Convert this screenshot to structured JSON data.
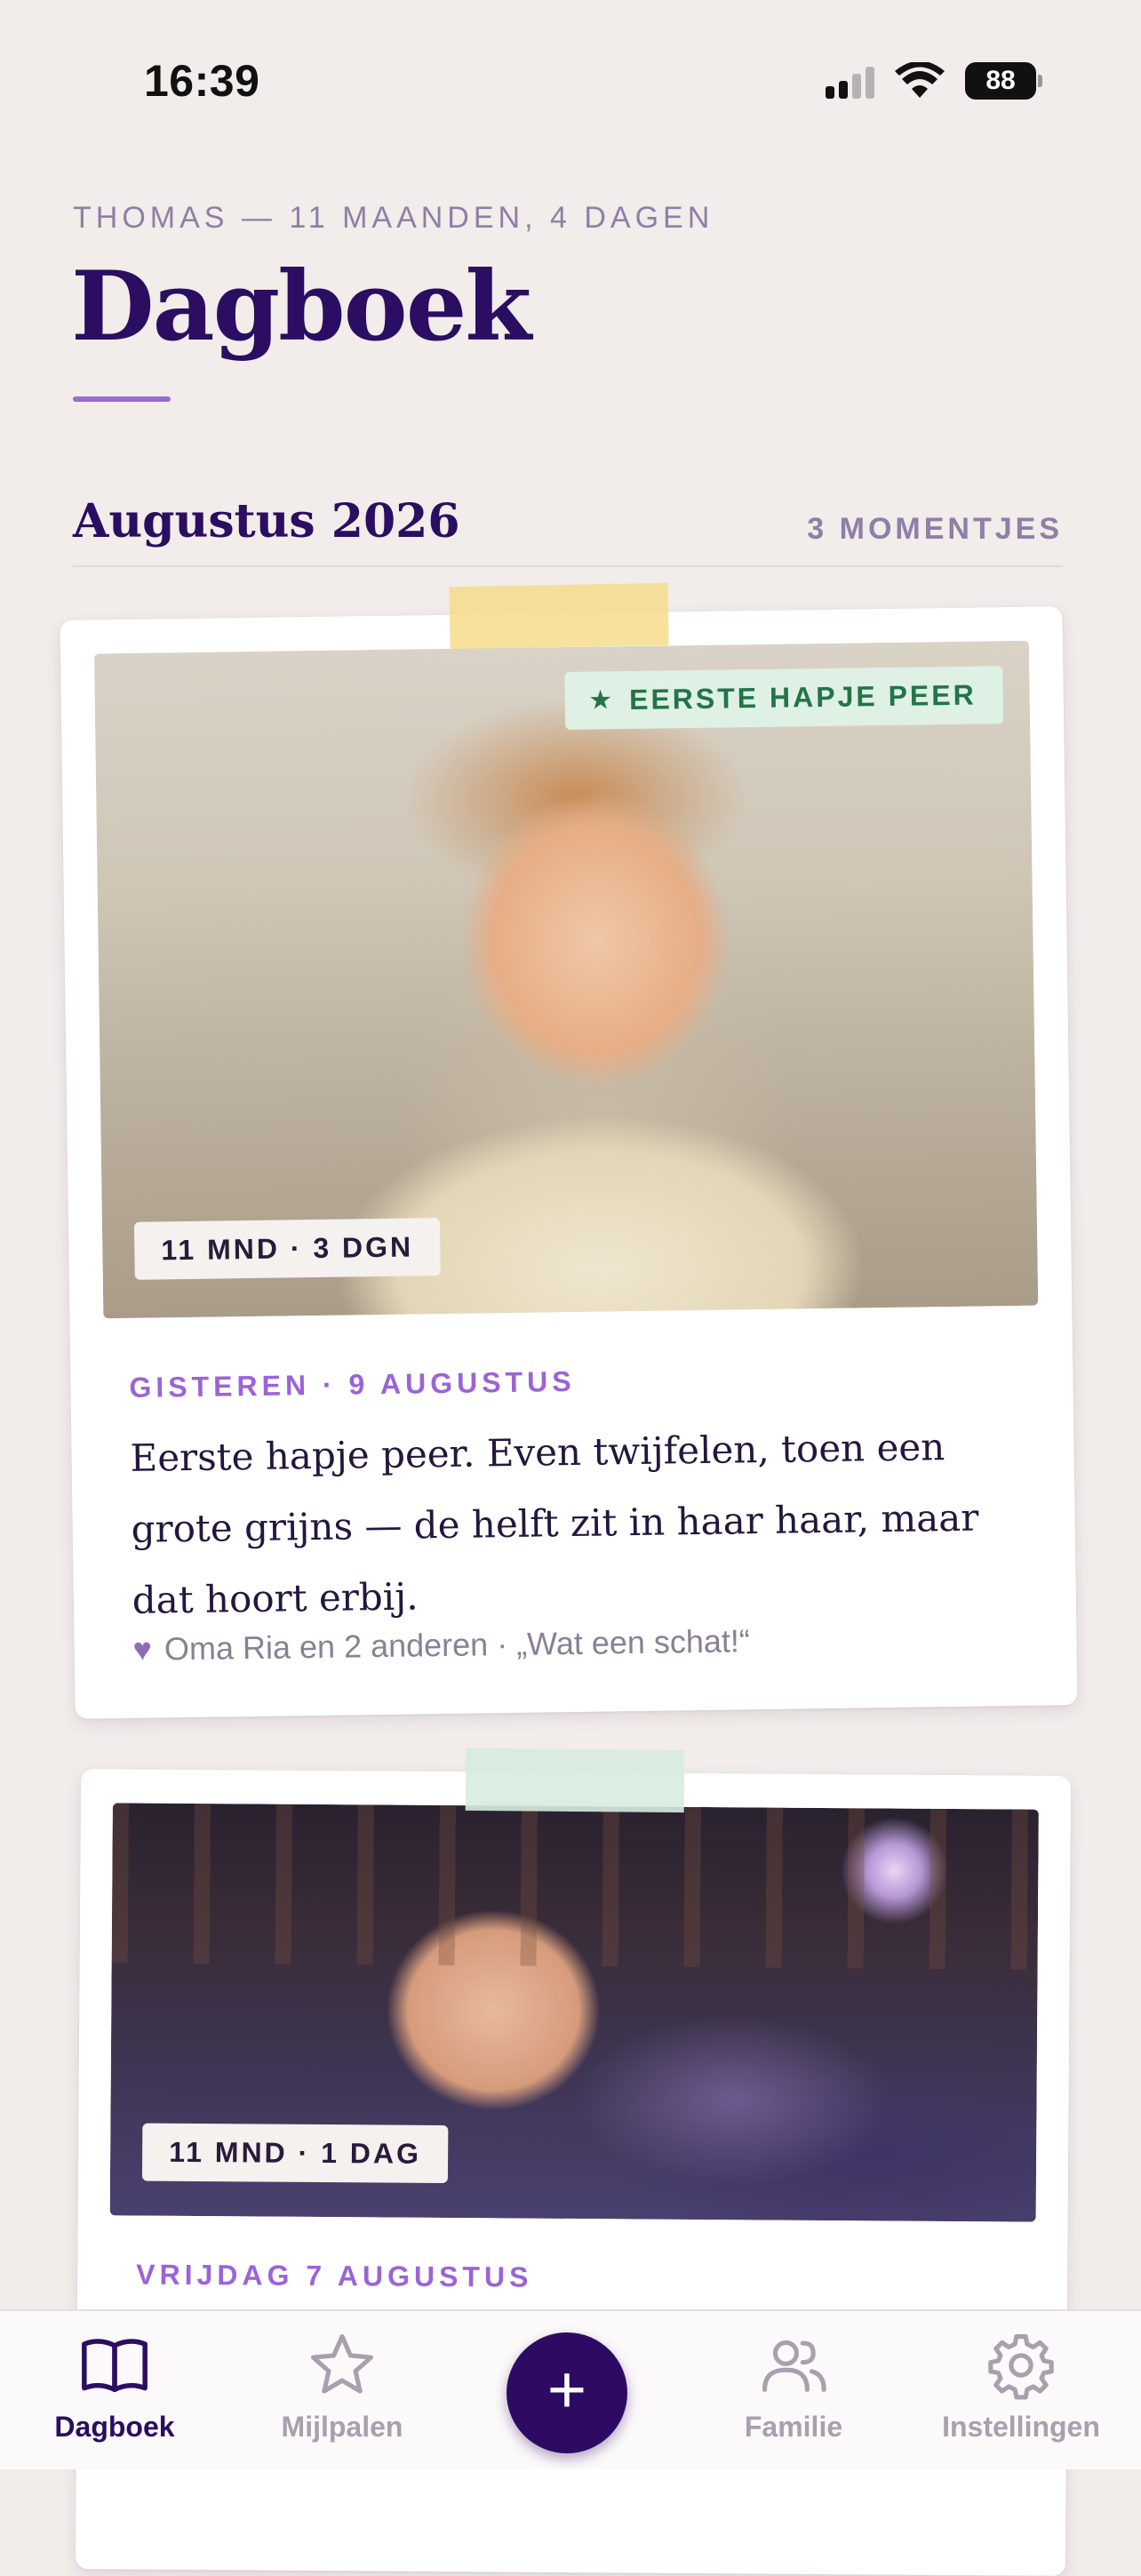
{
  "status_bar": {
    "time": "16:39",
    "battery": "88"
  },
  "header": {
    "subtitle": "THOMAS — 11 MAANDEN, 4 DAGEN",
    "title": "Dagboek"
  },
  "section": {
    "month": "Augustus 2026",
    "count": "3 MOMENTJES"
  },
  "entries": [
    {
      "milestone": "EERSTE HAPJE PEER",
      "age": "11 MND · 3 DGN",
      "date": "GISTEREN · 9 AUGUSTUS",
      "text": "Eerste hapje peer. Even twijfelen, toen een grote grijns — de helft zit in haar haar, maar dat hoort erbij.",
      "reactions": "Oma Ria en 2 anderen · „Wat een schat!“"
    },
    {
      "age": "11 MND · 1 DAG",
      "date": "VRIJDAG 7 AUGUSTUS"
    }
  ],
  "tabs": {
    "dagboek": "Dagboek",
    "mijlpalen": "Mijlpalen",
    "familie": "Familie",
    "instellingen": "Instellingen",
    "add": "+"
  },
  "colors": {
    "accent": "#2b0d62",
    "accent_light": "#9b63d8",
    "milestone_bg": "#dff0e4",
    "milestone_text": "#237447",
    "background": "#f2ecea"
  },
  "icons": {
    "battery": "battery-icon",
    "wifi": "wifi-icon",
    "signal": "signal-icon",
    "star": "star-icon",
    "heart": "heart-icon",
    "book": "book-icon",
    "people": "people-icon",
    "gear": "gear-icon",
    "plus": "plus-icon"
  }
}
